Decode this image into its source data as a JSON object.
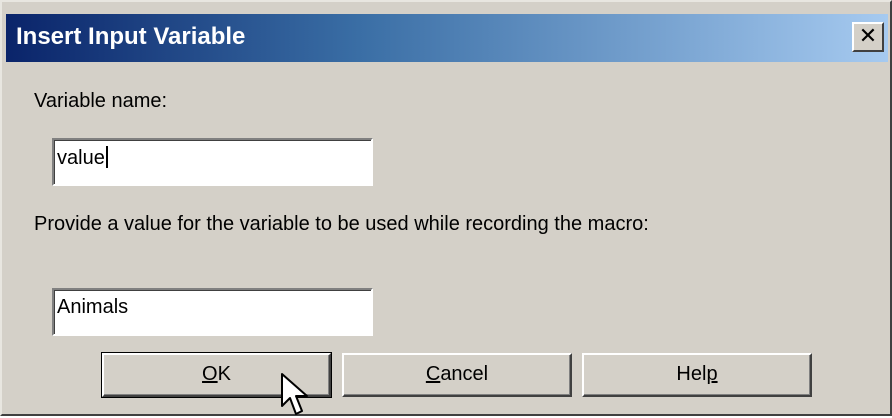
{
  "dialog": {
    "title": "Insert Input Variable",
    "close_glyph": "✕"
  },
  "form": {
    "variable_name_label": "Variable name:",
    "variable_name_value": "value",
    "value_label": "Provide a value for the variable to be used while recording the macro:",
    "value_value": "Animals"
  },
  "buttons": {
    "ok": {
      "mnemonic": "O",
      "rest": "K"
    },
    "cancel": {
      "mnemonic": "C",
      "rest": "ancel"
    },
    "help": {
      "before": "Hel",
      "mnemonic": "p"
    }
  },
  "icons": {
    "close": "close-icon",
    "cursor": "mouse-pointer-icon"
  },
  "colors": {
    "title_start": "#0a246a",
    "title_end": "#a6caf0",
    "face": "#d4d0c8"
  }
}
